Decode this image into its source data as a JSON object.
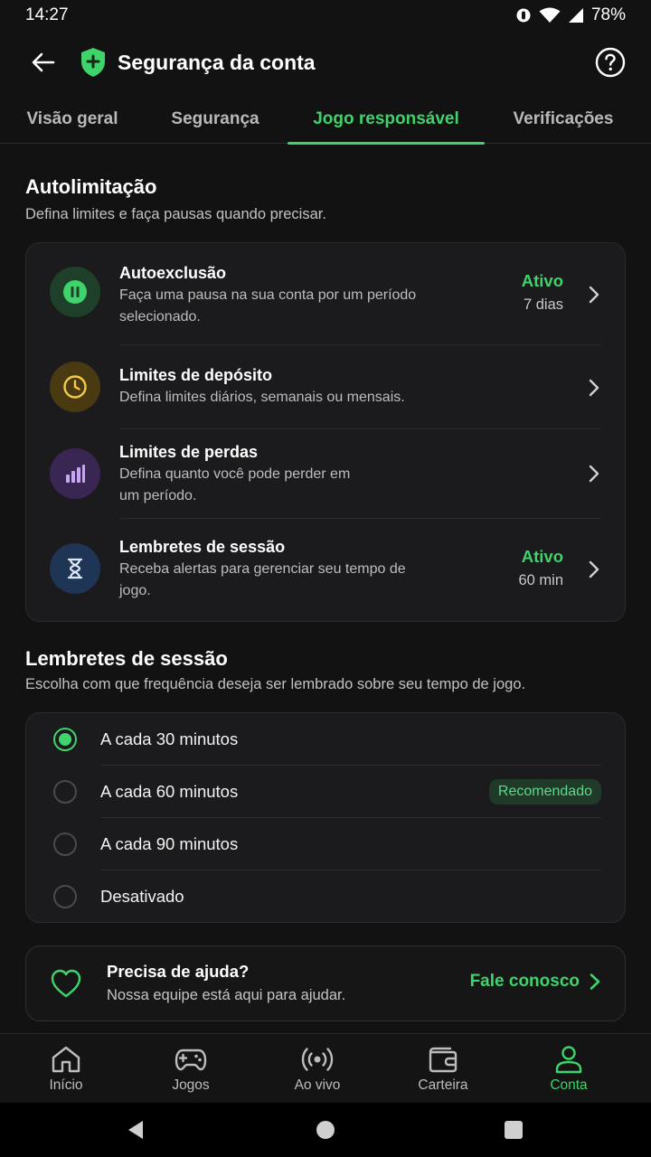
{
  "status_bar": {
    "time": "14:27",
    "battery": "78%"
  },
  "app_bar": {
    "title": "Segurança da conta"
  },
  "tabs": [
    {
      "label": "Visão geral"
    },
    {
      "label": "Segurança"
    },
    {
      "label": "Jogo responsável"
    },
    {
      "label": "Verificações"
    }
  ],
  "autolimit": {
    "title": "Autolimitação",
    "subtitle": "Defina limites e faça pausas quando precisar.",
    "items": [
      {
        "title": "Autoexclusão",
        "desc": "Faça uma pausa na sua conta por um período selecionado.",
        "status": "Ativo",
        "value": "7 dias",
        "icon": "pause-icon",
        "icon_bg": "#1e3f2a",
        "icon_color": "#3ed36b"
      },
      {
        "title": "Limites de depósito",
        "desc": "Defina limites diários, semanais ou mensais.",
        "status": "",
        "value": "",
        "icon": "clock-icon",
        "icon_bg": "#4a3a12",
        "icon_color": "#f2c94c"
      },
      {
        "title": "Limites de perdas",
        "desc": "Defina quanto você pode perder em um período.",
        "status": "",
        "value": "",
        "icon": "chart-icon",
        "icon_bg": "#3a2652",
        "icon_color": "#c7a6f5"
      },
      {
        "title": "Lembretes de sessão",
        "desc": "Receba alertas para gerenciar seu tempo de jogo.",
        "status": "Ativo",
        "value": "60 min",
        "icon": "hourglass-icon",
        "icon_bg": "#1f3556",
        "icon_color": "#dfe8f7"
      }
    ]
  },
  "reminders": {
    "title": "Lembretes de sessão",
    "subtitle": "Escolha com que frequência deseja ser lembrado sobre seu tempo de jogo.",
    "options": [
      {
        "label": "A cada 30 minutos",
        "checked": true,
        "badge": ""
      },
      {
        "label": "A cada 60 minutos",
        "checked": false,
        "badge": "Recomendado"
      },
      {
        "label": "A cada 90 minutos",
        "checked": false,
        "badge": ""
      },
      {
        "label": "Desativado",
        "checked": false,
        "badge": ""
      }
    ]
  },
  "help": {
    "title": "Precisa de ajuda?",
    "subtitle": "Nossa equipe está aqui para ajudar.",
    "link": "Fale conosco"
  },
  "bottom_nav": [
    {
      "label": "Início",
      "icon": "home-icon"
    },
    {
      "label": "Jogos",
      "icon": "gamepad-icon"
    },
    {
      "label": "Ao vivo",
      "icon": "live-icon"
    },
    {
      "label": "Carteira",
      "icon": "wallet-icon"
    },
    {
      "label": "Conta",
      "icon": "user-icon"
    }
  ],
  "colors": {
    "accent": "#3ed36b",
    "background": "#121212",
    "card": "#1b1b1d"
  }
}
